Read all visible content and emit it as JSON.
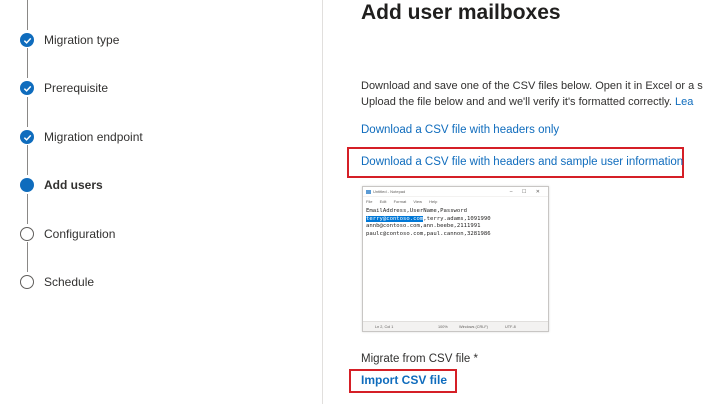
{
  "sidebar": {
    "steps": [
      {
        "label": "Migration type",
        "state": "done"
      },
      {
        "label": "Prerequisite",
        "state": "done"
      },
      {
        "label": "Migration endpoint",
        "state": "done"
      },
      {
        "label": "Add users",
        "state": "current"
      },
      {
        "label": "Configuration",
        "state": "todo"
      },
      {
        "label": "Schedule",
        "state": "todo"
      }
    ]
  },
  "main": {
    "title": "Add user mailboxes",
    "description_line1": "Download and save one of the CSV files below. Open it in Excel or a s",
    "description_line2": "Upload the file below and and we'll verify it's formatted correctly. ",
    "description_link_fragment": "Lea",
    "download_headers_only": "Download a CSV file with headers only",
    "download_with_sample": "Download a CSV file with headers and sample user information",
    "migrate_label": "Migrate from CSV file *",
    "import_button": "Import CSV file"
  },
  "notepad": {
    "title": "Untitled - Notepad",
    "window_controls": "– ☐ ✕",
    "menu": [
      "File",
      "Edit",
      "Format",
      "View",
      "Help"
    ],
    "line1": "EmailAddress,UserName,Password",
    "line2_selected": "terry@contoso.com",
    "line2_rest": ",terry.adams,1091990",
    "line3": "annb@contoso.com,ann.beebe,2111991",
    "line4": "paulc@contoso.com,paul.cannon,3281986",
    "status_position": "Ln 2, Col 1",
    "status_zoom": "100%",
    "status_eol": "Windows (CRLF)",
    "status_encoding": "UTF-8"
  },
  "colors": {
    "accent": "#0f6cbd",
    "highlight_box": "#d51f26"
  }
}
